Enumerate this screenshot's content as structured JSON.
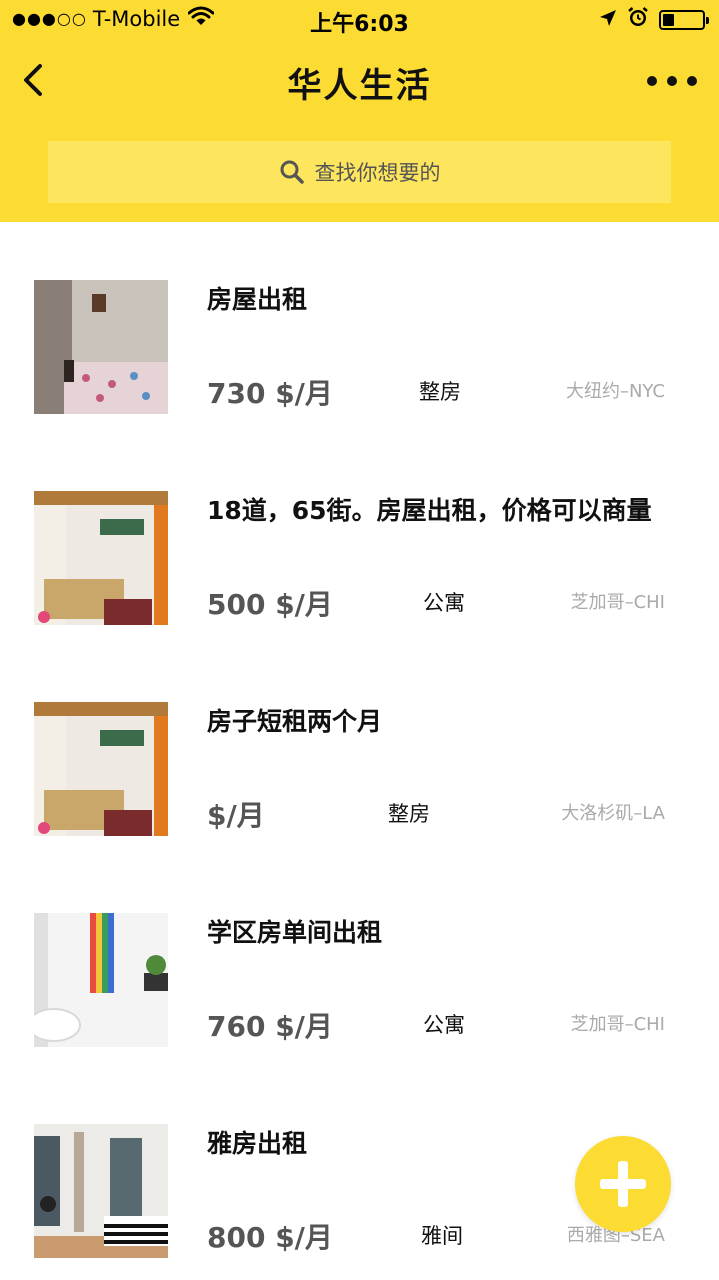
{
  "status_bar": {
    "signal": "●●●○○",
    "carrier": "T-Mobile",
    "time": "上午6:03"
  },
  "nav": {
    "title": "华人生活"
  },
  "search": {
    "placeholder": "查找你想要的"
  },
  "listings": [
    {
      "title": "房屋出租",
      "price": "730 $/月",
      "type": "整房",
      "city": "大纽约–NYC"
    },
    {
      "title": "18道，65街。房屋出租，价格可以商量",
      "price": "500 $/月",
      "type": "公寓",
      "city": "芝加哥–CHI"
    },
    {
      "title": "房子短租两个月",
      "price": "$/月",
      "type": "整房",
      "city": "大洛杉矶–LA"
    },
    {
      "title": "学区房单间出租",
      "price": "760 $/月",
      "type": "公寓",
      "city": "芝加哥–CHI"
    },
    {
      "title": "雅房出租",
      "price": "800 $/月",
      "type": "雅间",
      "city": "西雅图–SEA"
    }
  ],
  "colors": {
    "accent": "#fcdc33",
    "search_bg": "#fde55e"
  },
  "icons": [
    "wifi-icon",
    "location-arrow-icon",
    "alarm-icon",
    "battery-icon",
    "back-chevron-icon",
    "more-dots-icon",
    "search-icon",
    "add-icon"
  ]
}
